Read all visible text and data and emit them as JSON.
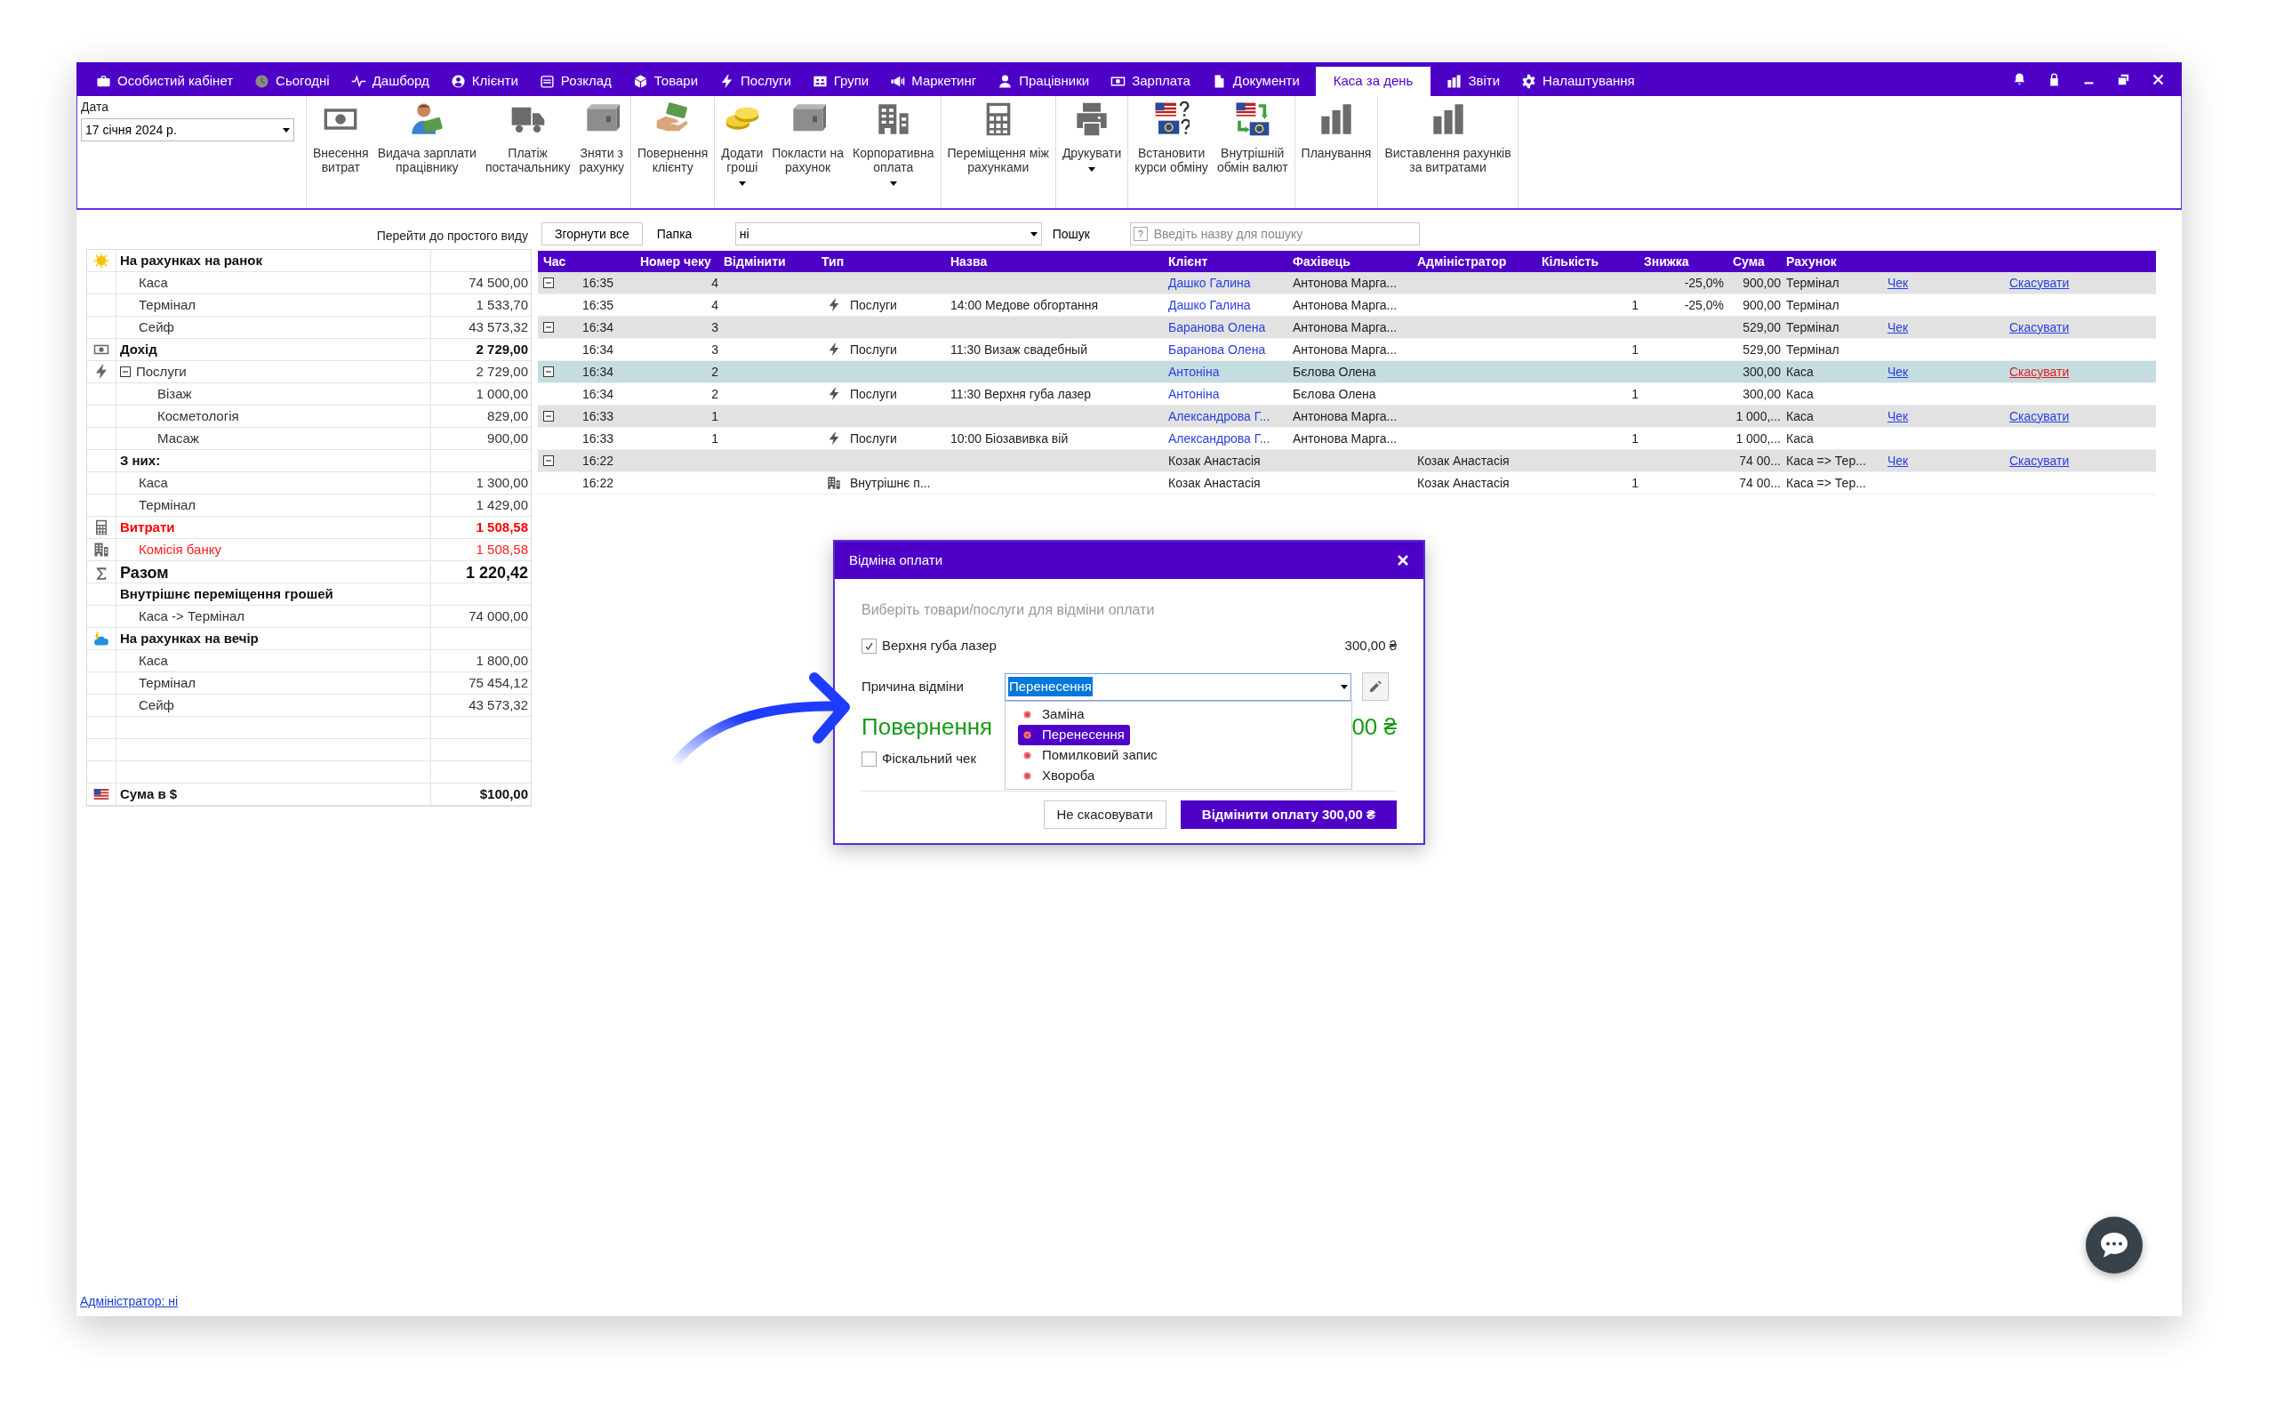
{
  "nav": {
    "tabs": [
      {
        "label": "Особистий кабінет",
        "selected": false
      },
      {
        "label": "Сьогодні",
        "selected": false
      },
      {
        "label": "Дашборд",
        "selected": false
      },
      {
        "label": "Клієнти",
        "selected": false
      },
      {
        "label": "Розклад",
        "selected": false
      },
      {
        "label": "Товари",
        "selected": false
      },
      {
        "label": "Послуги",
        "selected": false
      },
      {
        "label": "Групи",
        "selected": false
      },
      {
        "label": "Маркетинг",
        "selected": false
      },
      {
        "label": "Працівники",
        "selected": false
      },
      {
        "label": "Зарплата",
        "selected": false
      },
      {
        "label": "Документи",
        "selected": false
      },
      {
        "label": "Каса за день",
        "selected": true
      },
      {
        "label": "Звіти",
        "selected": false
      },
      {
        "label": "Налаштування",
        "selected": false
      }
    ]
  },
  "toolbar": {
    "date": {
      "label": "Дата",
      "value": "17 січня 2024 р."
    },
    "groups": [
      {
        "buttons": [
          {
            "label": "Внесення\nвитрат",
            "dropdown": false
          },
          {
            "label": "Видача зарплати\nпрацівнику",
            "dropdown": false
          },
          {
            "label": "Платіж\nпостачальнику",
            "dropdown": false
          },
          {
            "label": "Зняти з\nрахунку",
            "dropdown": false
          }
        ]
      },
      {
        "buttons": [
          {
            "label": "Повернення\nклієнту",
            "dropdown": false
          }
        ]
      },
      {
        "buttons": [
          {
            "label": "Додати\nгроші",
            "dropdown": true
          },
          {
            "label": "Покласти на\nрахунок",
            "dropdown": false
          },
          {
            "label": "Корпоративна\nоплата",
            "dropdown": true
          }
        ]
      },
      {
        "buttons": [
          {
            "label": "Переміщення між\nрахунками",
            "dropdown": false
          }
        ]
      },
      {
        "buttons": [
          {
            "label": "Друкувати",
            "dropdown": true
          }
        ]
      },
      {
        "buttons": [
          {
            "label": "Встановити\nкурси обміну",
            "dropdown": false
          },
          {
            "label": "Внутрішній\nобмін валют",
            "dropdown": false
          }
        ]
      },
      {
        "buttons": [
          {
            "label": "Планування",
            "dropdown": false
          }
        ]
      },
      {
        "buttons": [
          {
            "label": "Виставлення рахунків\nза витратами",
            "dropdown": false
          }
        ]
      }
    ]
  },
  "summary": {
    "link": "Перейти до простого виду",
    "rows": [
      {
        "kind": "section",
        "label": "На рахунках на ранок",
        "value": ""
      },
      {
        "kind": "item",
        "label": "Каса",
        "value": "74 500,00"
      },
      {
        "kind": "item",
        "label": "Термінал",
        "value": "1 533,70"
      },
      {
        "kind": "item",
        "label": "Сейф",
        "value": "43 573,32"
      },
      {
        "kind": "section",
        "label": "Дохід",
        "value": "2 729,00"
      },
      {
        "kind": "group",
        "label": "Послуги",
        "value": "2 729,00",
        "expanded": true
      },
      {
        "kind": "subitem",
        "label": "Візаж",
        "value": "1 000,00"
      },
      {
        "kind": "subitem",
        "label": "Косметологія",
        "value": "829,00"
      },
      {
        "kind": "subitem",
        "label": "Масаж",
        "value": "900,00"
      },
      {
        "kind": "section",
        "label": "З них:",
        "value": ""
      },
      {
        "kind": "item",
        "label": "Каса",
        "value": "1 300,00"
      },
      {
        "kind": "item",
        "label": "Термінал",
        "value": "1 429,00"
      },
      {
        "kind": "expense",
        "label": "Витрати",
        "value": "1 508,58"
      },
      {
        "kind": "expense_item",
        "label": "Комісія банку",
        "value": "1 508,58"
      },
      {
        "kind": "total",
        "label": "Разом",
        "value": "1 220,42"
      },
      {
        "kind": "section",
        "label": "Внутрішнє переміщення грошей",
        "value": ""
      },
      {
        "kind": "item",
        "label": "Каса -> Термінал",
        "value": "74 000,00"
      },
      {
        "kind": "section",
        "label": "На рахунках на вечір",
        "value": ""
      },
      {
        "kind": "item",
        "label": "Каса",
        "value": "1 800,00"
      },
      {
        "kind": "item",
        "label": "Термінал",
        "value": "75 454,12"
      },
      {
        "kind": "item",
        "label": "Сейф",
        "value": "43 573,32"
      },
      {
        "kind": "blank"
      },
      {
        "kind": "blank"
      },
      {
        "kind": "blank"
      },
      {
        "kind": "section",
        "label": "Сума в $",
        "value": "$100,00"
      }
    ]
  },
  "table": {
    "controls": {
      "collapse_button": "Згорнути все",
      "folder": {
        "label": "Папка",
        "value": "ні"
      },
      "search": {
        "label": "Пошук",
        "help": "?",
        "placeholder": "Введіть назву для пошуку"
      }
    },
    "columns": [
      "Час",
      "Номер чеку",
      "Відмінити",
      "Тип",
      "Назва",
      "Клієнт",
      "Фахівець",
      "Адміністратор",
      "Кількість",
      "Знижка",
      "Сума",
      "Рахунок"
    ],
    "rows": [
      {
        "kind": "group",
        "expanded": true,
        "selected": false,
        "time": "16:35",
        "receipt": "4",
        "client": "Дашко Галина",
        "client_link": true,
        "specialist": "Антонова Марга...",
        "discount": "-25,0%",
        "sum": "900,00",
        "account": "Термінал",
        "receipt_link": "Чек",
        "cancel_link": "Скасувати"
      },
      {
        "kind": "detail",
        "selected": false,
        "time": "16:35",
        "receipt": "4",
        "type": "Послуги",
        "name": "14:00 Медове обгортання",
        "client": "Дашко Галина",
        "client_link": true,
        "specialist": "Антонова Марга...",
        "qty": "1",
        "discount": "-25,0%",
        "sum": "900,00",
        "account": "Термінал"
      },
      {
        "kind": "group",
        "expanded": true,
        "selected": false,
        "time": "16:34",
        "receipt": "3",
        "client": "Баранова Олена",
        "client_link": true,
        "specialist": "Антонова Марга...",
        "sum": "529,00",
        "account": "Термінал",
        "receipt_link": "Чек",
        "cancel_link": "Скасувати"
      },
      {
        "kind": "detail",
        "selected": false,
        "time": "16:34",
        "receipt": "3",
        "type": "Послуги",
        "name": "11:30 Визаж свадебный",
        "client": "Баранова Олена",
        "client_link": true,
        "specialist": "Антонова Марга...",
        "qty": "1",
        "sum": "529,00",
        "account": "Термінал"
      },
      {
        "kind": "group",
        "expanded": true,
        "selected": true,
        "time": "16:34",
        "receipt": "2",
        "client": "Антоніна",
        "client_link": true,
        "specialist": "Бєлова Олена",
        "sum": "300,00",
        "account": "Каса",
        "receipt_link": "Чек",
        "cancel_link": "Скасувати"
      },
      {
        "kind": "detail",
        "selected": false,
        "time": "16:34",
        "receipt": "2",
        "type": "Послуги",
        "name": "11:30 Верхня губа лазер",
        "client": "Антоніна",
        "client_link": true,
        "specialist": "Бєлова Олена",
        "qty": "1",
        "sum": "300,00",
        "account": "Каса"
      },
      {
        "kind": "group",
        "expanded": true,
        "selected": false,
        "time": "16:33",
        "receipt": "1",
        "client": "Александрова Г...",
        "client_link": true,
        "specialist": "Антонова Марга...",
        "sum": "1 000,...",
        "account": "Каса",
        "receipt_link": "Чек",
        "cancel_link": "Скасувати"
      },
      {
        "kind": "detail",
        "selected": false,
        "time": "16:33",
        "receipt": "1",
        "type": "Послуги",
        "name": "10:00 Біозавивка вій",
        "client": "Александрова Г...",
        "client_link": true,
        "specialist": "Антонова Марга...",
        "qty": "1",
        "sum": "1 000,...",
        "account": "Каса"
      },
      {
        "kind": "group",
        "expanded": true,
        "selected": false,
        "time": "16:22",
        "client": "Козак Анастасія",
        "client_link": false,
        "admin": "Козак Анастасія",
        "sum": "74 00...",
        "account": "Каса => Тер...",
        "receipt_link": "Чек",
        "cancel_link": "Скасувати"
      },
      {
        "kind": "detail",
        "selected": false,
        "time": "16:22",
        "type": "Внутрішнє п...",
        "client": "Козак Анастасія",
        "client_link": false,
        "admin": "Козак Анастасія",
        "qty": "1",
        "sum": "74 00...",
        "account": "Каса => Тер..."
      }
    ]
  },
  "dialog": {
    "title": "Відміна оплати",
    "hint": "Виберіть товари/послуги для відміни оплати",
    "items": [
      {
        "label": "Верхня губа лазер",
        "checked": true,
        "price": "300,00 ₴"
      }
    ],
    "reason": {
      "label": "Причина відміни",
      "value": "Перенесення",
      "expanded": true,
      "options": [
        {
          "label": "Заміна",
          "selected": false
        },
        {
          "label": "Перенесення",
          "selected": true
        },
        {
          "label": "Помилковий запис",
          "selected": false
        },
        {
          "label": "Хвороба",
          "selected": false
        }
      ]
    },
    "refund": {
      "label": "Повернення",
      "amount": "00 ₴"
    },
    "fiscal": {
      "label": "Фіскальний чек",
      "checked": false
    },
    "buttons": [
      {
        "label": "Не скасовувати",
        "kind": "secondary"
      },
      {
        "label": "Відмінити оплату 300,00 ₴",
        "kind": "primary"
      }
    ]
  },
  "status_link": "Адміністратор: ні"
}
